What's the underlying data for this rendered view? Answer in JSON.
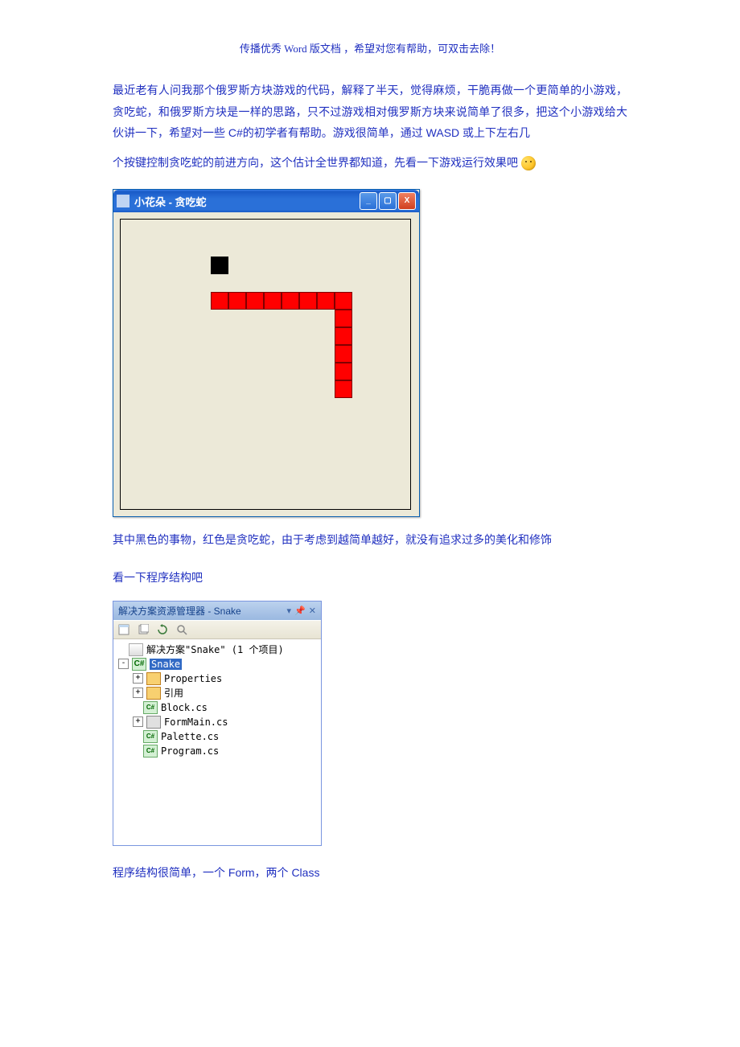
{
  "header_note": "传播优秀 Word 版文档 ，希望对您有帮助，可双击去除！",
  "para1": "最近老有人问我那个俄罗斯方块游戏的代码，解释了半天，觉得麻烦，干脆再做一个更简单的小游戏，贪吃蛇，和俄罗斯方块是一样的思路，只不过游戏相对俄罗斯方块来说简单了很多，把这个小游戏给大伙讲一下，希望对一些 C#的初学者有帮助。游戏很简单，通过 WASD 或上下左右几",
  "para2": "个按键控制贪吃蛇的前进方向，这个估计全世界都知道，先看一下游戏运行效果吧",
  "game_window": {
    "title": "小花朵 - 贪吃蛇",
    "food": {
      "col": 5,
      "row": 2
    },
    "snake": [
      {
        "col": 5,
        "row": 4
      },
      {
        "col": 6,
        "row": 4
      },
      {
        "col": 7,
        "row": 4
      },
      {
        "col": 8,
        "row": 4
      },
      {
        "col": 9,
        "row": 4
      },
      {
        "col": 10,
        "row": 4
      },
      {
        "col": 11,
        "row": 4
      },
      {
        "col": 12,
        "row": 4
      },
      {
        "col": 12,
        "row": 5
      },
      {
        "col": 12,
        "row": 6
      },
      {
        "col": 12,
        "row": 7
      },
      {
        "col": 12,
        "row": 8
      },
      {
        "col": 12,
        "row": 9
      }
    ]
  },
  "para3": "其中黑色的事物，红色是贪吃蛇，由于考虑到越简单越好，就没有追求过多的美化和修饰",
  "para4": "看一下程序结构吧",
  "solution": {
    "title": "解决方案资源管理器 - Snake",
    "root": "解决方案\"Snake\" (1 个项目)",
    "project": "Snake",
    "nodes": [
      {
        "label": "Properties",
        "icon": "folder",
        "expandable": true
      },
      {
        "label": "引用",
        "icon": "folder",
        "expandable": true
      },
      {
        "label": "Block.cs",
        "icon": "cs",
        "expandable": false
      },
      {
        "label": "FormMain.cs",
        "icon": "form",
        "expandable": true
      },
      {
        "label": "Palette.cs",
        "icon": "cs",
        "expandable": false
      },
      {
        "label": "Program.cs",
        "icon": "cs",
        "expandable": false
      }
    ]
  },
  "para5": "程序结构很简单，一个 Form，两个 Class"
}
